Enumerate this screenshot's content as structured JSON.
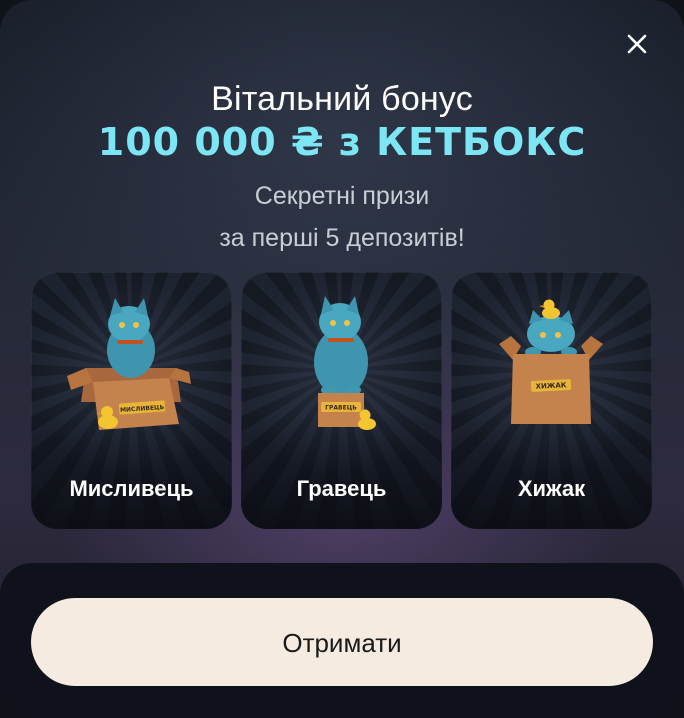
{
  "modal": {
    "title": "Вітальний бонус",
    "headline": "100 000 ₴ з КЕТБОКС",
    "subtitle_line1": "Секретні призи",
    "subtitle_line2": "за перші 5 депозитів!",
    "close_icon": "close-icon",
    "accent_color": "#7de6f5"
  },
  "cards": [
    {
      "label": "Мисливець",
      "box_label": "МИСЛИВЕЦЬ"
    },
    {
      "label": "Гравець",
      "box_label": "ГРАВЕЦЬ"
    },
    {
      "label": "Хижак",
      "box_label": "ХИЖАК"
    }
  ],
  "cta": {
    "label": "Отримати"
  }
}
